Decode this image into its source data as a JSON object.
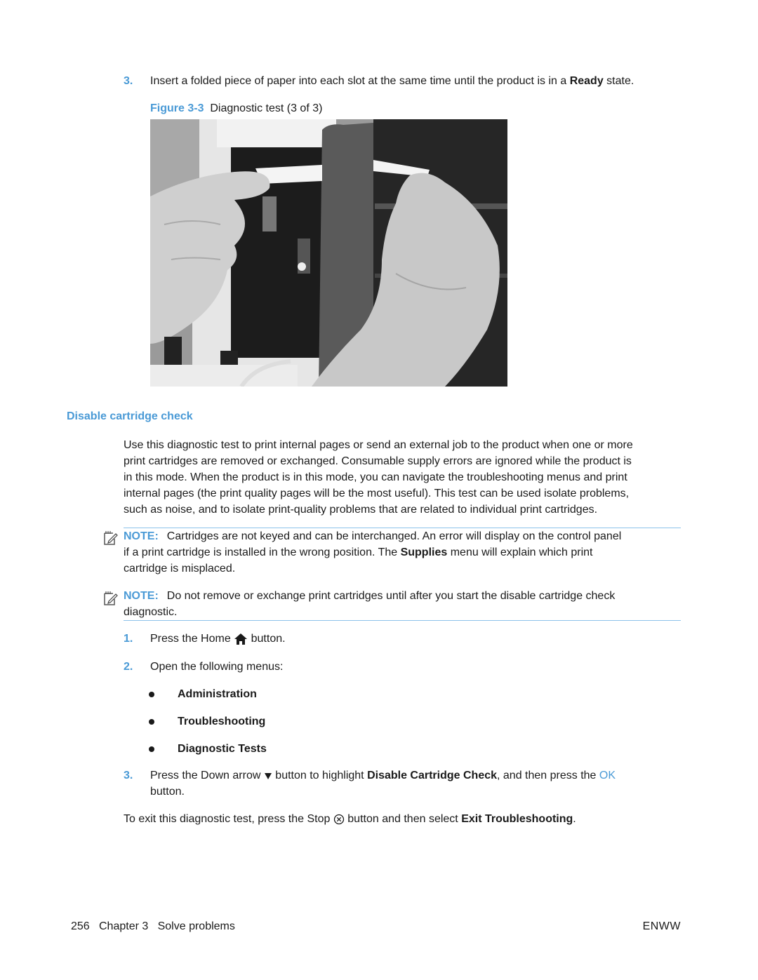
{
  "top_step": {
    "number": "3.",
    "text_before": "Insert a folded piece of paper into each slot at the same time until the product is in a ",
    "bold": "Ready",
    "text_after": " state."
  },
  "figure": {
    "label": "Figure 3-3",
    "caption": "Diagnostic test (3 of 3)",
    "image_description": "Grayscale photo of two hands inserting folded paper strips into printer cartridge slots"
  },
  "section": {
    "heading": "Disable cartridge check",
    "paragraph_lines": [
      "Use this diagnostic test to print internal pages or send an external job to the product when one or more",
      "print cartridges are removed or exchanged. Consumable supply errors are ignored while the product is",
      "in this mode. When the product is in this mode, you can navigate the troubleshooting menus and print",
      "internal pages (the print quality pages will be the most useful). This test can be used isolate problems,",
      "such as noise, and to isolate print-quality problems that are related to individual print cartridges."
    ]
  },
  "notes": [
    {
      "label": "NOTE:",
      "line1": "Cartridges are not keyed and can be interchanged. An error will display on the control panel",
      "line2_before": "if a print cartridge is installed in the wrong position. The ",
      "line2_bold": "Supplies",
      "line2_after": " menu will explain which print",
      "line3": "cartridge is misplaced."
    },
    {
      "label": "NOTE:",
      "line1": "Do not remove or exchange print cartridges until after you start the disable cartridge check",
      "line2": "diagnostic."
    }
  ],
  "steps": [
    {
      "number": "1.",
      "before": "Press the Home",
      "icon": "home-icon",
      "after": "button."
    },
    {
      "number": "2.",
      "text": "Open the following menus:"
    },
    {
      "number": "3.",
      "before": "Press the Down arrow",
      "icon": "down-arrow-icon",
      "middle": "button to highlight ",
      "bold": "Disable Cartridge Check",
      "after": ", and then press the ",
      "link": "OK",
      "line2": "button."
    }
  ],
  "menus": [
    "Administration",
    "Troubleshooting",
    "Diagnostic Tests"
  ],
  "exit_note": {
    "before": "To exit this diagnostic test, press the Stop",
    "icon": "stop-icon",
    "middle": "button and then select ",
    "bold": "Exit Troubleshooting",
    "after": "."
  },
  "footer": {
    "page_number": "256",
    "chapter": "Chapter 3   Solve problems",
    "right": "ENWW"
  },
  "colors": {
    "accent": "#4a9ad6",
    "rule": "#8cc2ea",
    "text": "#1a1a1a"
  }
}
